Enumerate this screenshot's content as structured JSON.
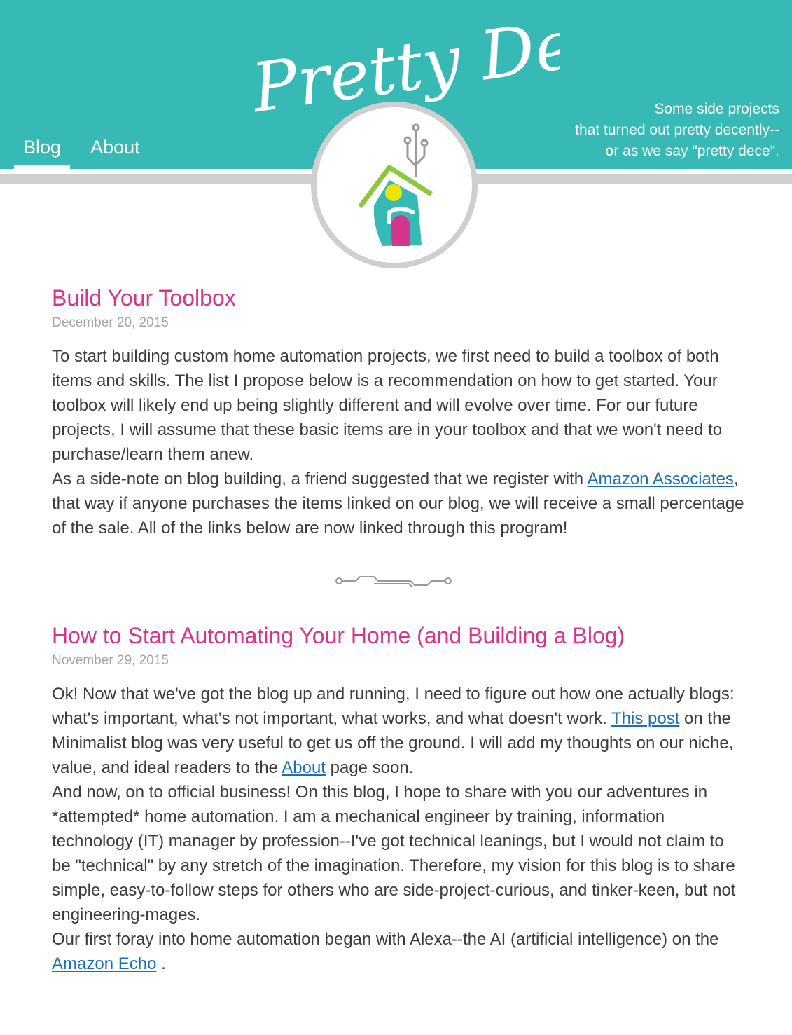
{
  "site": {
    "title": "Pretty Dece",
    "tagline": [
      "Some side projects",
      "that turned out pretty decently--",
      "or as we say \"pretty dece\"."
    ]
  },
  "nav": {
    "blog": "Blog",
    "about": "About"
  },
  "posts": [
    {
      "title": "Build Your Toolbox",
      "date": "December 20, 2015",
      "p1": "To start building custom home automation projects, we first need to build a toolbox of both items and skills. The list I propose below is a recommendation on how to get started. Your toolbox will likely end up being slightly different and will evolve over time. For our future projects, I will assume that these basic items are in your toolbox and that we won't need to purchase/learn them anew.",
      "p2_before": "As a side-note on blog building, a friend suggested that we register with ",
      "p2_link": "Amazon Associates",
      "p2_after": ", that way if anyone purchases the items linked on our blog, we will receive a small percentage of the sale. All of the links below are now linked through this program!"
    },
    {
      "title": "How to Start Automating Your Home (and Building a Blog)",
      "date": "November 29, 2015",
      "p1_before": "Ok! Now that we've got the blog up and running, I need to figure out how one actually blogs: what's important, what's not important, what works, and what doesn't work. ",
      "p1_link": "This post",
      "p1_middle": " on the Minimalist blog was very useful to get us off the ground. I will add my thoughts on our niche, value, and ideal readers to the ",
      "p1_link2": "About",
      "p1_after": " page soon.",
      "p2": "And now, on to official business! On this blog, I hope to share with you our adventures in *attempted* home automation. I am a mechanical engineer by training, information technology (IT) manager by profession--I've got technical leanings, but I would not claim to be \"technical\" by any stretch of the imagination. Therefore, my vision for this blog is to share simple, easy-to-follow steps for others who are side-project-curious, and tinker-keen, but not engineering-mages.",
      "p3_before": "Our first foray into home automation began with Alexa--the AI (artificial intelligence) on the ",
      "p3_link": "Amazon Echo",
      "p3_after": "  ."
    }
  ],
  "colors": {
    "header_bg": "#37bab5",
    "title_pink": "#d6358c",
    "link_blue": "#1a6fb5",
    "gray_bar": "#cfcfcf"
  },
  "icons": {
    "logo": "house-logo-icon",
    "divider": "circuit-divider-icon"
  }
}
